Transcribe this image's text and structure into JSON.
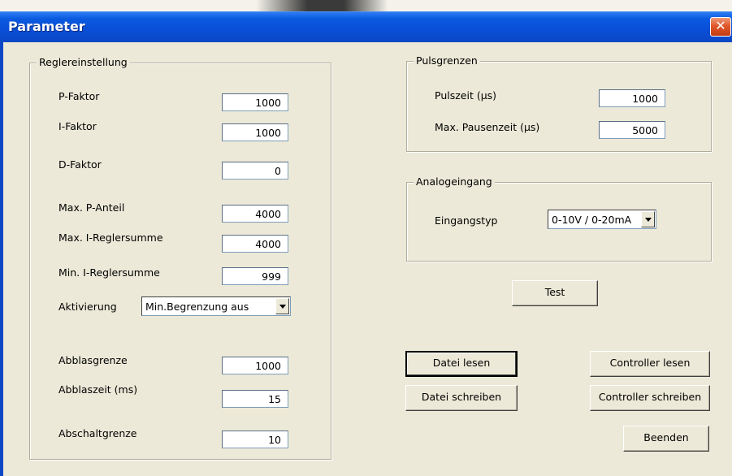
{
  "window": {
    "title": "Parameter",
    "close_icon": "close-x-icon"
  },
  "regler": {
    "group_label": "Reglereinstellung",
    "p_faktor": {
      "label": "P-Faktor",
      "value": "1000"
    },
    "i_faktor": {
      "label": "I-Faktor",
      "value": "1000"
    },
    "d_faktor": {
      "label": "D-Faktor",
      "value": "0"
    },
    "max_p_anteil": {
      "label": "Max. P-Anteil",
      "value": "4000"
    },
    "max_i_reglersumme": {
      "label": "Max. I-Reglersumme",
      "value": "4000"
    },
    "min_i_reglersumme": {
      "label": "Min. I-Reglersumme",
      "value": "999"
    },
    "aktivierung": {
      "label": "Aktivierung",
      "selected": "Min.Begrenzung aus"
    },
    "abblasgrenze": {
      "label": "Abblasgrenze",
      "value": "1000"
    },
    "abblaszeit": {
      "label": "Abblaszeit (ms)",
      "value": "15"
    },
    "abschaltgrenze": {
      "label": "Abschaltgrenze",
      "value": "10"
    }
  },
  "puls": {
    "group_label": "Pulsgrenzen",
    "pulszeit": {
      "label": "Pulszeit (µs)",
      "value": "1000"
    },
    "max_pausenzeit": {
      "label": "Max. Pausenzeit (µs)",
      "value": "5000"
    }
  },
  "analog": {
    "group_label": "Analogeingang",
    "eingangstyp": {
      "label": "Eingangstyp",
      "selected": "0-10V / 0-20mA"
    }
  },
  "buttons": {
    "test": "Test",
    "datei_lesen": "Datei lesen",
    "datei_schreiben": "Datei schreiben",
    "controller_lesen": "Controller lesen",
    "controller_schreiben": "Controller schreiben",
    "beenden": "Beenden"
  },
  "colors": {
    "titlebar": "#0a4fd8",
    "dialog_bg": "#ece9d8",
    "close_button": "#e0582a"
  }
}
